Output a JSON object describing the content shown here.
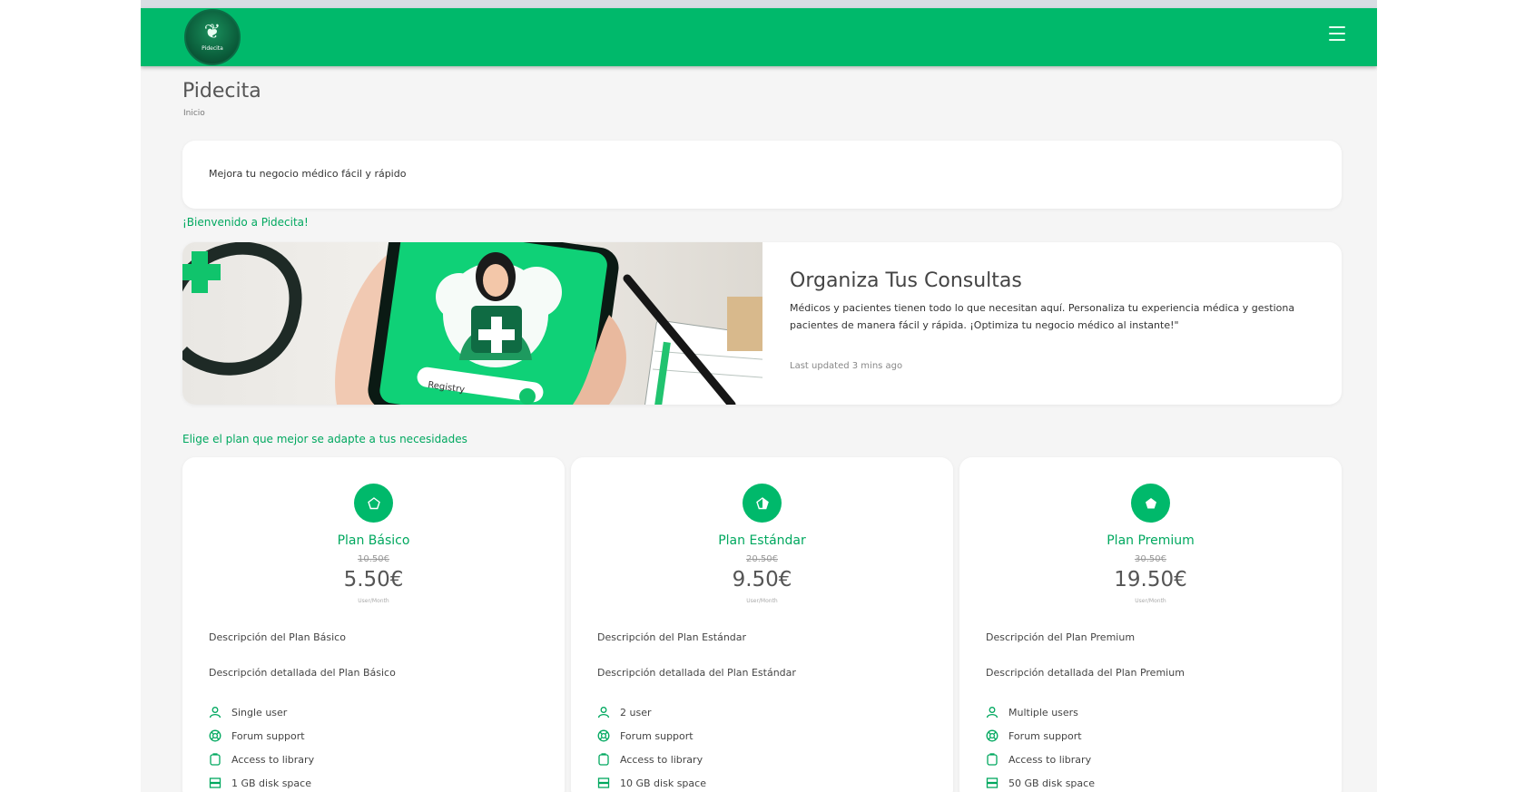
{
  "app": {
    "logo_text": "Pidecita",
    "menu_icon": "hamburger-menu-icon"
  },
  "page": {
    "title": "Pidecita",
    "breadcrumb": "Inicio"
  },
  "intro": {
    "text": "Mejora tu negocio médico fácil y rápido"
  },
  "welcome": "¡Bienvenido a Pidecita!",
  "feature": {
    "title": "Organiza Tus Consultas",
    "description": "Médicos y pacientes tienen todo lo que necesitan aquí. Personaliza tu experiencia médica y gestiona pacientes de manera fácil y rápida. ¡Optimiza tu negocio médico al instante!\"",
    "updated": "Last updated 3 mins ago",
    "image_text": "Registry"
  },
  "plans_heading": "Elige el plan que mejor se adapte a tus necesidades",
  "plans": [
    {
      "name": "Plan Básico",
      "old_price": "10.50€",
      "price": "5.50€",
      "unit": "User/Month",
      "description": "Descripción del Plan Básico",
      "detail": "Descripción detallada del Plan Básico",
      "icon": "pentagon-outline-icon",
      "features": [
        "Single user",
        "Forum support",
        "Access to library",
        "1 GB disk space"
      ]
    },
    {
      "name": "Plan Estándar",
      "old_price": "20.50€",
      "price": "9.50€",
      "unit": "User/Month",
      "description": "Descripción del Plan Estándar",
      "detail": "Descripción detallada del Plan Estándar",
      "icon": "pentagon-half-icon",
      "features": [
        "2 user",
        "Forum support",
        "Access to library",
        "10 GB disk space"
      ]
    },
    {
      "name": "Plan Premium",
      "old_price": "30.50€",
      "price": "19.50€",
      "unit": "User/Month",
      "description": "Descripción del Plan Premium",
      "detail": "Descripción detallada del Plan Premium",
      "icon": "pentagon-filled-icon",
      "features": [
        "Multiple users",
        "Forum support",
        "Access to library",
        "50 GB disk space"
      ]
    }
  ],
  "colors": {
    "brand": "#00b96b",
    "accent_text": "#00a85f"
  }
}
